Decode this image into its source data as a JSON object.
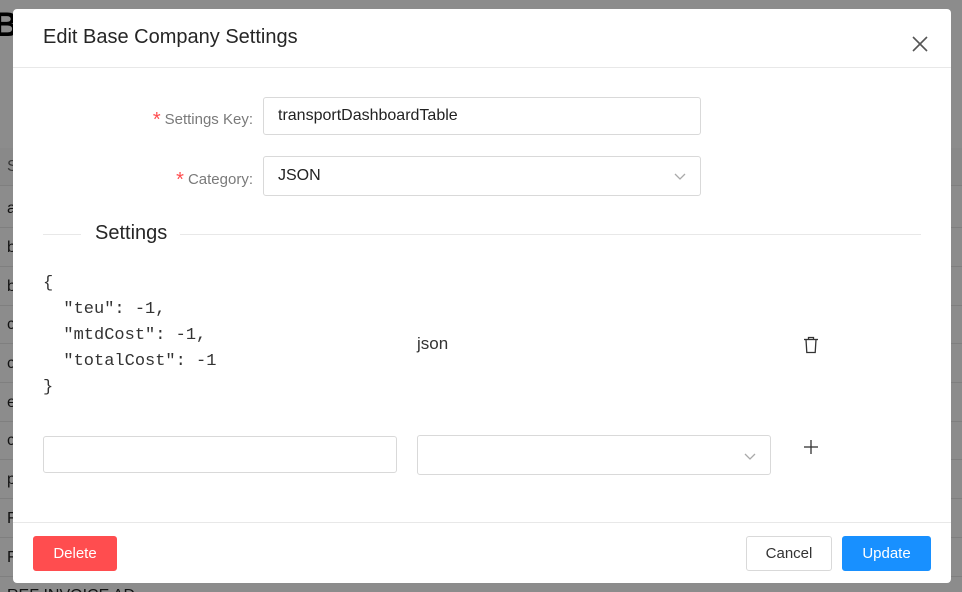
{
  "background": {
    "title_fragment": "Ba",
    "header_fragment": "S",
    "row_fragments": [
      "a",
      "b",
      "b",
      "c",
      "c",
      "e",
      "c",
      "p",
      "F",
      "F"
    ],
    "bottom_text": "REF INVOICE AD"
  },
  "modal": {
    "title": "Edit Base Company Settings",
    "close_icon": "close-icon"
  },
  "form": {
    "settings_key": {
      "label": "Settings Key",
      "value": "transportDashboardTable",
      "required": true
    },
    "category": {
      "label": "Category",
      "value": "JSON",
      "required": true
    }
  },
  "settings_section": {
    "title": "Settings",
    "entries": [
      {
        "value": "{\n  \"teu\": -1,\n  \"mtdCost\": -1,\n  \"totalCost\": -1\n}",
        "type": "json",
        "delete_icon": "trash-icon"
      }
    ],
    "new_entry": {
      "value_placeholder": "",
      "type_placeholder": "",
      "add_icon": "plus-icon"
    }
  },
  "footer": {
    "delete_label": "Delete",
    "cancel_label": "Cancel",
    "update_label": "Update"
  },
  "colors": {
    "primary": "#1890ff",
    "danger": "#ff4d4f",
    "required": "#ff4d4f"
  }
}
